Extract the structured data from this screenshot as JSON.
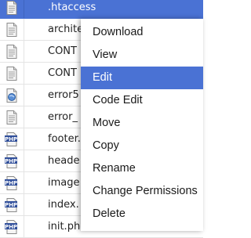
{
  "file_list": {
    "rows": [
      {
        "name": ".htaccess",
        "icon": "text-file-icon",
        "selected": true
      },
      {
        "name": "archite",
        "icon": "text-file-icon",
        "selected": false
      },
      {
        "name": "CONT",
        "icon": "text-file-icon",
        "selected": false
      },
      {
        "name": "CONT",
        "icon": "text-file-icon",
        "selected": false
      },
      {
        "name": "error5",
        "icon": "error-page-icon",
        "selected": false
      },
      {
        "name": "error_",
        "icon": "text-file-icon",
        "selected": false
      },
      {
        "name": "footer.",
        "icon": "php-file-icon",
        "selected": false
      },
      {
        "name": "heade",
        "icon": "php-file-icon",
        "selected": false
      },
      {
        "name": "image",
        "icon": "php-file-icon",
        "selected": false
      },
      {
        "name": "index.",
        "icon": "php-file-icon",
        "selected": false
      },
      {
        "name": "init.ph",
        "icon": "php-file-icon",
        "selected": false
      }
    ]
  },
  "context_menu": {
    "items": [
      {
        "label": "Download",
        "highlighted": false
      },
      {
        "label": "View",
        "highlighted": false
      },
      {
        "label": "Edit",
        "highlighted": true
      },
      {
        "label": "Code Edit",
        "highlighted": false
      },
      {
        "label": "Move",
        "highlighted": false
      },
      {
        "label": "Copy",
        "highlighted": false
      },
      {
        "label": "Rename",
        "highlighted": false
      },
      {
        "label": "Change Permissions",
        "highlighted": false
      },
      {
        "label": "Delete",
        "highlighted": false
      }
    ]
  },
  "icons": {
    "php_badge_text": "PHP"
  },
  "colors": {
    "selection": "#4a72d4",
    "row_divider": "#e4e4e4",
    "text": "#222222"
  }
}
